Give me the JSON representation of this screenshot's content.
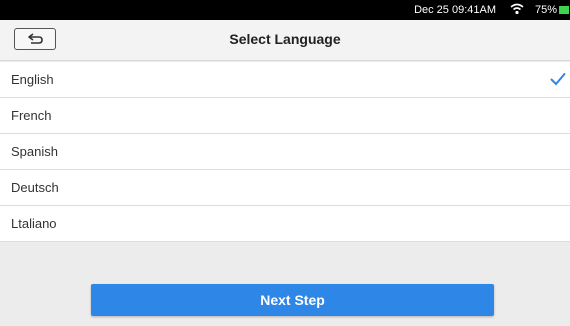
{
  "status_bar": {
    "time": "Dec 25 09:41AM",
    "battery": "75%",
    "wifi_icon": "wifi-icon",
    "battery_color": "#3ed44e"
  },
  "header": {
    "title": "Select Language",
    "back_icon": "back-arrow-icon"
  },
  "languages": [
    {
      "label": "English",
      "selected": true
    },
    {
      "label": "French",
      "selected": false
    },
    {
      "label": "Spanish",
      "selected": false
    },
    {
      "label": "Deutsch",
      "selected": false
    },
    {
      "label": "Ltaliano",
      "selected": false
    }
  ],
  "next_button": {
    "label": "Next Step",
    "color": "#2e86e6"
  },
  "accent_color": "#2e86e6"
}
